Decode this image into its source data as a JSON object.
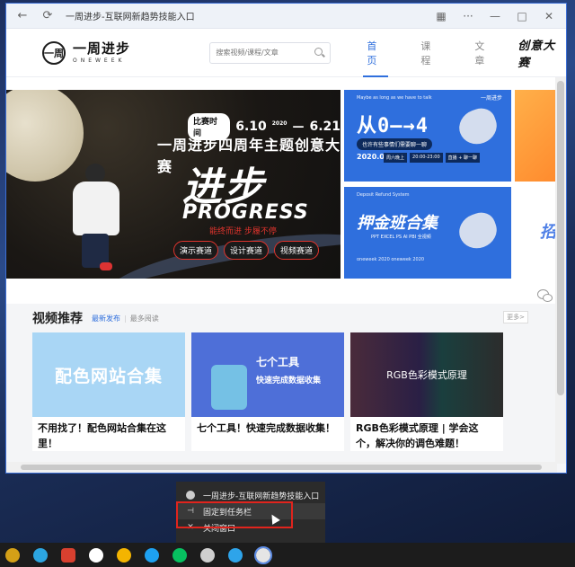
{
  "window": {
    "title": "一周进步-互联网新趋势技能入口",
    "controls": {
      "minimize": "—",
      "maximize": "□",
      "close": "✕"
    }
  },
  "header": {
    "logo_mark": "一周",
    "logo_cn": "一周进步",
    "logo_en": "ONEWEEK",
    "search_placeholder": "搜索视频/课程/文章",
    "nav": [
      "首页",
      "课程",
      "文章"
    ],
    "active_nav": "首页",
    "brand_badge": "创意大赛"
  },
  "main_banner": {
    "tag": "比赛时间",
    "date_start": "6.10",
    "year": "2020",
    "dash": "—",
    "date_end": "6.21",
    "title": "一周进步四周年主题创意大赛",
    "big_text": "进步",
    "progress_word": "PROGRESS",
    "slogan": "能终而进 步履不停",
    "tracks": [
      "演示赛道",
      "设计赛道",
      "视频赛道"
    ]
  },
  "side_banner_1": {
    "small_text": "Maybe as long as we have to talk",
    "corner_text": "一周进步",
    "headline": "从0—→4",
    "pill": "也许有些事情们需要聊一聊",
    "date": "2020.06.06",
    "time_tags": [
      "周六晚上",
      "20:00-23:00",
      "直播 + 聊一聊"
    ]
  },
  "side_banner_2": {
    "small_text": "Deposit Refund System",
    "headline": "押金班合集",
    "sub": "PPT EXCEL PS AI PBI 全视频",
    "foot": "oneweek 2020 oneweek 2020"
  },
  "side_ghost_text": "招",
  "section": {
    "title": "视频推荐",
    "tab_active": "最新发布",
    "separator": "|",
    "tab_other": "最多阅读",
    "more": "更多>"
  },
  "cards": [
    {
      "thumb_text": "配色网站合集",
      "title": "不用找了！配色网站合集在这里！"
    },
    {
      "thumb_text_1": "七个工具",
      "thumb_text_2": "快速完成数据收集",
      "title": "七个工具！快速完成数据收集！"
    },
    {
      "thumb_text": "RGB色彩模式原理",
      "title": "RGB色彩模式原理 | 学会这个，解决你的调色难题！"
    }
  ],
  "context_menu": {
    "items": [
      "一周进步-互联网新趋势技能入口",
      "固定到任务栏",
      "关闭窗口"
    ],
    "highlighted": "固定到任务栏"
  },
  "taskbar": {
    "icons": [
      "chrome-icon",
      "telegram-icon",
      "screen-icon",
      "game-icon",
      "todo-icon",
      "edge-icon",
      "wechat-icon",
      "settings-icon",
      "edge-beta-icon",
      "pwa-icon"
    ],
    "colors": [
      "#d4a017",
      "#2ca5e0",
      "#d8402f",
      "#ffffff",
      "#f4b400",
      "#1ea1f1",
      "#07c160",
      "#cfcfcf",
      "#2ea4ea",
      "#e5e5e5"
    ]
  }
}
